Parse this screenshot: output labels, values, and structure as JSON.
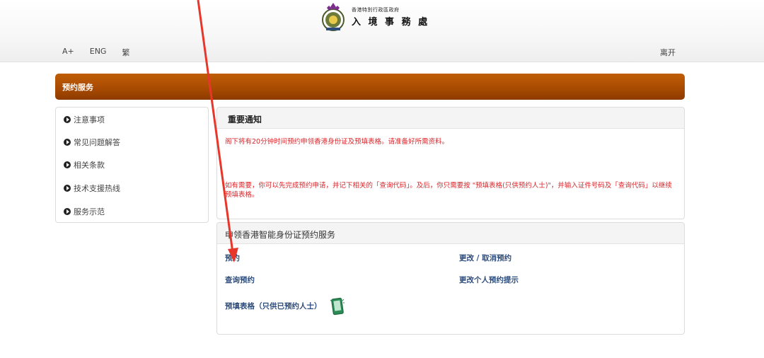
{
  "header": {
    "logo_small": "香港特別行政區政府",
    "logo_big": "入 境 事 務 處",
    "tools": [
      "A+",
      "ENG",
      "繁"
    ],
    "leave_label": "离开"
  },
  "banner": {
    "title": "预约服务"
  },
  "sidebar": {
    "items": [
      {
        "label": "注意事项"
      },
      {
        "label": "常见问题解答"
      },
      {
        "label": "相关条款"
      },
      {
        "label": "技术支援热线"
      },
      {
        "label": "服务示范"
      }
    ]
  },
  "notice": {
    "title": "重要通知",
    "line1": "阁下将有20分钟时间预约申领香港身份证及预填表格。请准备好所需资料。",
    "line2": "如有需要，你可以先完成预约申请，并记下相关的「查询代码」。及后，你只需要按 \"预填表格(只供预约人士)\"，并输入证件号码及「查询代码」以继续预填表格。"
  },
  "service": {
    "title": "申领香港智能身份证预约服务",
    "links": {
      "book": "预约",
      "change": "更改 / 取消预约",
      "enquire": "查询预约",
      "reminder": "更改个人预约提示",
      "prefill": "预填表格（只供已预约人士）"
    }
  },
  "colors": {
    "banner": "#a94b02",
    "notice_text": "#d9262b",
    "link": "#2d4c7c",
    "annotation_arrow": "#e8372a"
  }
}
